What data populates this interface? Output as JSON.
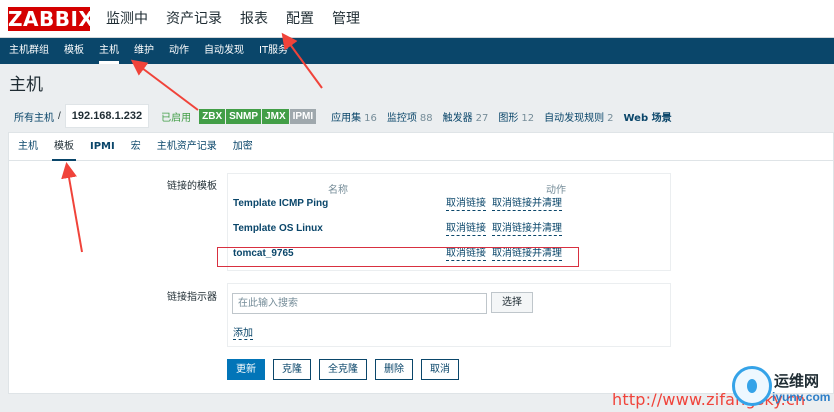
{
  "logo": "ZABBIX",
  "top_menu": [
    {
      "label": "监测中"
    },
    {
      "label": "资产记录"
    },
    {
      "label": "报表"
    },
    {
      "label": "配置"
    },
    {
      "label": "管理"
    }
  ],
  "sub_menu": [
    {
      "label": "主机群组"
    },
    {
      "label": "模板"
    },
    {
      "label": "主机",
      "active": true
    },
    {
      "label": "维护"
    },
    {
      "label": "动作"
    },
    {
      "label": "自动发现"
    },
    {
      "label": "IT服务"
    }
  ],
  "page_title": "主机",
  "host_nav": {
    "all_hosts": "所有主机",
    "separator": "/",
    "current_host": "192.168.1.232",
    "status": "已启用",
    "badges": [
      {
        "label": "ZBX",
        "color": "#429e47"
      },
      {
        "label": "SNMP",
        "color": "#429e47"
      },
      {
        "label": "JMX",
        "color": "#429e47"
      },
      {
        "label": "IPMI",
        "color": "#9fa8ad"
      }
    ],
    "links": [
      {
        "label": "应用集",
        "count": "16"
      },
      {
        "label": "监控项",
        "count": "88"
      },
      {
        "label": "触发器",
        "count": "27"
      },
      {
        "label": "图形",
        "count": "12"
      },
      {
        "label": "自动发现规则",
        "count": "2"
      },
      {
        "label": "Web 场景",
        "count": ""
      }
    ]
  },
  "tabs": [
    {
      "label": "主机"
    },
    {
      "label": "模板",
      "active": true
    },
    {
      "label": "IPMI"
    },
    {
      "label": "宏"
    },
    {
      "label": "主机资产记录"
    },
    {
      "label": "加密"
    }
  ],
  "form": {
    "linked_templates_label": "链接的模板",
    "col_name": "名称",
    "col_action": "动作",
    "templates": [
      {
        "name": "Template ICMP Ping",
        "unlink": "取消链接",
        "unlink_clear": "取消链接并清理"
      },
      {
        "name": "Template OS Linux",
        "unlink": "取消链接",
        "unlink_clear": "取消链接并清理"
      },
      {
        "name": "tomcat_9765",
        "unlink": "取消链接",
        "unlink_clear": "取消链接并清理"
      }
    ],
    "link_indicator_label": "链接指示器",
    "search_placeholder": "在此输入搜索",
    "select_button": "选择",
    "add_link": "添加"
  },
  "buttons": {
    "update": "更新",
    "clone": "克隆",
    "full_clone": "全克隆",
    "delete": "删除",
    "cancel": "取消"
  },
  "watermark": {
    "url": "http://www.zifangsky.cn",
    "site_cn": "运维网",
    "site_en": "iyunv.com"
  },
  "colors": {
    "brand_red": "#d40000",
    "nav_blue": "#0a466a",
    "primary_button": "#0275b8",
    "enabled_green": "#429e47",
    "annotation_red": "#f0433a"
  }
}
